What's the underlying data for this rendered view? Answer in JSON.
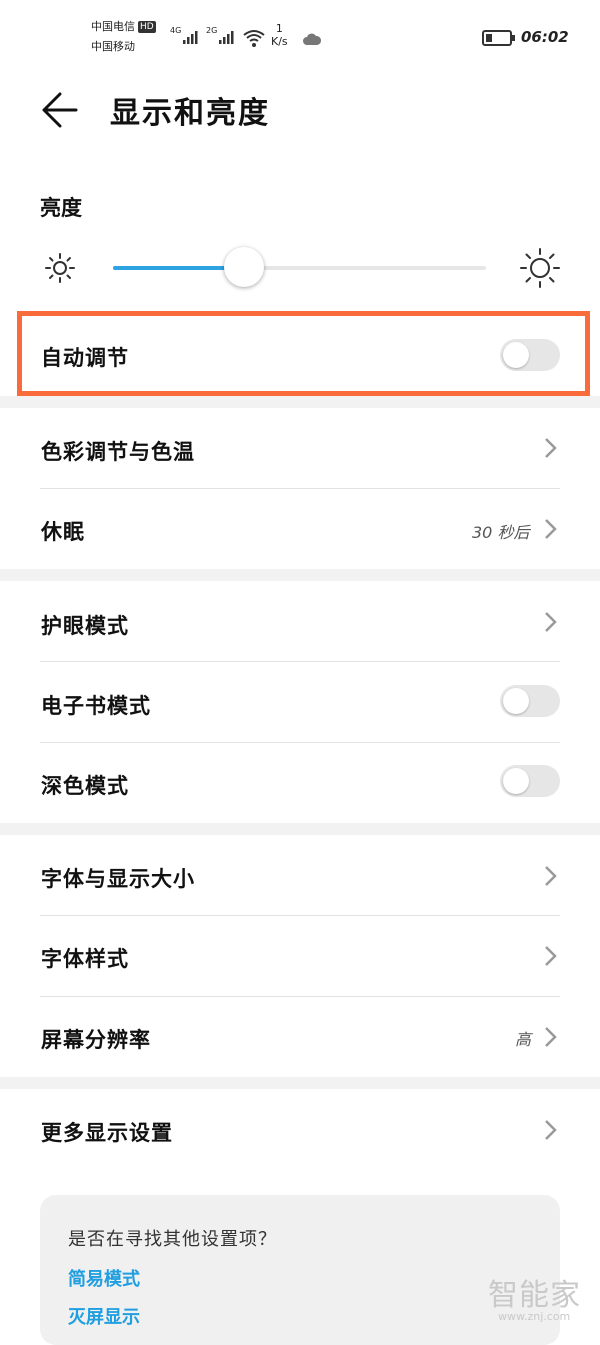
{
  "status_bar": {
    "carrier1": "中国电信",
    "hd": "HD",
    "carrier2": "中国移动",
    "net1": "4G",
    "net2": "2G",
    "speed_value": "1",
    "speed_unit": "K/s",
    "time": "06:02",
    "icons": [
      "signal-icon",
      "wifi-icon",
      "cloud-icon",
      "battery-icon"
    ]
  },
  "header": {
    "title": "显示和亮度",
    "back_icon": "back-arrow-icon"
  },
  "brightness": {
    "label": "亮度",
    "level": 0.35,
    "min_icon": "sun-small-icon",
    "max_icon": "sun-large-icon"
  },
  "auto_adjust": {
    "label": "自动调节",
    "enabled": false
  },
  "groups": [
    {
      "items": [
        {
          "label": "色彩调节与色温",
          "type": "chevron"
        },
        {
          "label": "休眠",
          "value": "30 秒后",
          "type": "chevron"
        }
      ]
    },
    {
      "items": [
        {
          "label": "护眼模式",
          "type": "chevron"
        },
        {
          "label": "电子书模式",
          "type": "toggle",
          "enabled": false
        },
        {
          "label": "深色模式",
          "type": "toggle",
          "enabled": false
        }
      ]
    },
    {
      "items": [
        {
          "label": "字体与显示大小",
          "type": "chevron"
        },
        {
          "label": "字体样式",
          "type": "chevron"
        },
        {
          "label": "屏幕分辨率",
          "value": "高",
          "type": "chevron"
        }
      ]
    },
    {
      "items": [
        {
          "label": "更多显示设置",
          "type": "chevron"
        }
      ]
    }
  ],
  "suggestions": {
    "title": "是否在寻找其他设置项？",
    "links": [
      "简易模式",
      "灭屏显示"
    ]
  },
  "watermark": {
    "text": "智能家",
    "url": "www.znj.com"
  },
  "colors": {
    "accent": "#2ea3e1",
    "highlight": "#fa6b3c",
    "link": "#1f9ee0",
    "section_gap": "#f2f2f2"
  }
}
